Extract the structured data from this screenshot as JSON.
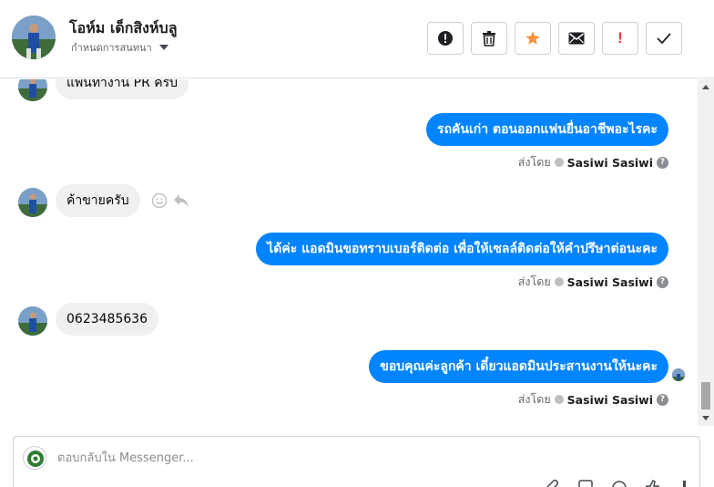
{
  "header": {
    "contact_name": "โอห์ม เด็กสิงห์บลู",
    "assign_label": "กำหนดการสนทนา"
  },
  "toolbar": {
    "buttons": [
      {
        "name": "report-spam",
        "icon": "alert-circle-icon"
      },
      {
        "name": "delete",
        "icon": "trash-icon"
      },
      {
        "name": "star",
        "icon": "star-icon",
        "color": "#f7923b"
      },
      {
        "name": "mark-unread",
        "icon": "envelope-icon"
      },
      {
        "name": "follow-up",
        "icon": "exclamation-icon",
        "label": "!",
        "color": "#fa383e"
      },
      {
        "name": "mark-done",
        "icon": "check-icon"
      }
    ]
  },
  "thread": {
    "messages": [
      {
        "direction": "in",
        "text": "แพนทางาน PR ครับ"
      },
      {
        "direction": "out",
        "text": "รถคันเก่า ตอนออกแฟนยื่นอาชีพอะไรคะ",
        "sent_by_label": "ส่งโดย",
        "sender": "Sasiwi Sasiwi"
      },
      {
        "direction": "in",
        "text": "ค้าขายครับ"
      },
      {
        "direction": "out",
        "text": "ได้ค่ะ แอดมินขอทราบเบอร์ติดต่อ เพื่อให้เซลล์ติดต่อให้คำปรึษาต่อนะคะ",
        "sent_by_label": "ส่งโดย",
        "sender": "Sasiwi Sasiwi"
      },
      {
        "direction": "in",
        "text": "0623485636"
      },
      {
        "direction": "out",
        "text": "ขอบคุณค่ะลูกค้า เดี๋ยวแอดมินประสานงานให้นะคะ",
        "sent_by_label": "ส่งโดย",
        "sender": "Sasiwi Sasiwi"
      }
    ]
  },
  "composer": {
    "placeholder": "ตอบกลับใน Messenger..."
  },
  "colors": {
    "outgoing_bubble": "#0084ff",
    "incoming_bubble": "#f0f0f0",
    "star": "#f7923b",
    "flag": "#fa383e"
  }
}
